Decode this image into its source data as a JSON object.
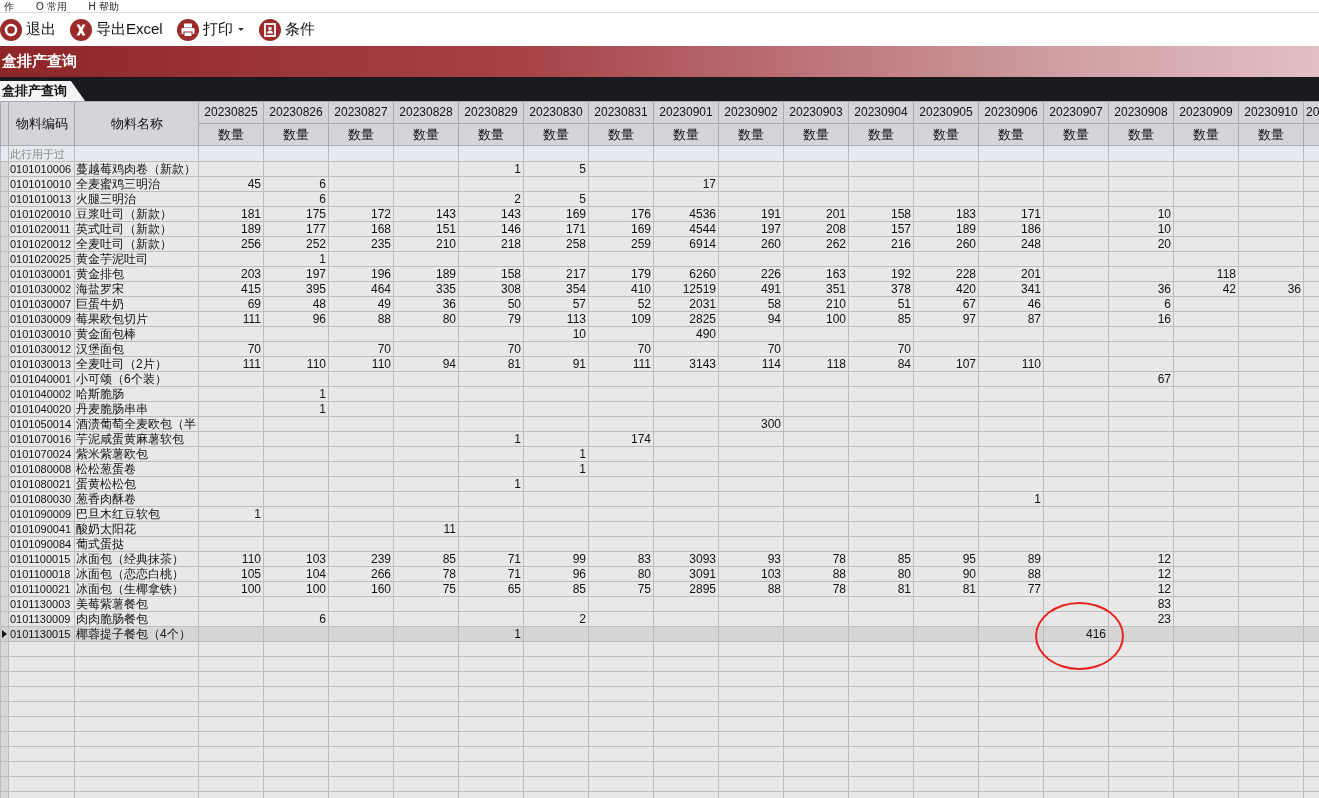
{
  "menu": [
    {
      "label": "作"
    },
    {
      "label": "O 常用"
    },
    {
      "label": "H 帮助"
    }
  ],
  "toolbar": [
    {
      "kind": "exit",
      "label": "退出",
      "dropdown": false
    },
    {
      "kind": "excel",
      "label": "导出Excel",
      "dropdown": false
    },
    {
      "kind": "print",
      "label": "打印",
      "dropdown": true
    },
    {
      "kind": "filter",
      "label": "条件",
      "dropdown": false
    }
  ],
  "title": "盒排产查询",
  "tabs": [
    {
      "label": "盒排产查询",
      "selected": true
    }
  ],
  "table": {
    "code_header": "物料编码",
    "name_header": "物料名称",
    "filter_hint": "此行用于过",
    "columns": [
      {
        "date": "20230825",
        "measure": "数量"
      },
      {
        "date": "20230826",
        "measure": "数量"
      },
      {
        "date": "20230827",
        "measure": "数量"
      },
      {
        "date": "20230828",
        "measure": "数量"
      },
      {
        "date": "20230829",
        "measure": "数量"
      },
      {
        "date": "20230830",
        "measure": "数量"
      },
      {
        "date": "20230831",
        "measure": "数量"
      },
      {
        "date": "20230901",
        "measure": "数量"
      },
      {
        "date": "20230902",
        "measure": "数量"
      },
      {
        "date": "20230903",
        "measure": "数量"
      },
      {
        "date": "20230904",
        "measure": "数量"
      },
      {
        "date": "20230905",
        "measure": "数量"
      },
      {
        "date": "20230906",
        "measure": "数量"
      },
      {
        "date": "20230907",
        "measure": "数量"
      },
      {
        "date": "20230908",
        "measure": "数量"
      },
      {
        "date": "20230909",
        "measure": "数量"
      },
      {
        "date": "20230910",
        "measure": "数量"
      },
      {
        "date": "20"
      }
    ],
    "rows": [
      {
        "code": "0101010006",
        "name": "蔓越莓鸡肉卷（新款）",
        "quantities": {
          "c4": "1",
          "c5": "5"
        },
        "selected": false,
        "circled": false
      },
      {
        "code": "0101010010",
        "name": "全麦蜜鸡三明治",
        "quantities": {
          "c0": "45",
          "c1": "6",
          "c7": "17"
        },
        "selected": false,
        "circled": false
      },
      {
        "code": "0101010013",
        "name": "火腿三明治",
        "quantities": {
          "c1": "6",
          "c4": "2",
          "c5": "5"
        },
        "selected": false,
        "circled": false
      },
      {
        "code": "0101020010",
        "name": "豆浆吐司（新款）",
        "quantities": {
          "c0": "181",
          "c1": "175",
          "c2": "172",
          "c3": "143",
          "c4": "143",
          "c5": "169",
          "c6": "176",
          "c7": "4536",
          "c8": "191",
          "c9": "201",
          "c10": "158",
          "c11": "183",
          "c12": "171",
          "c14": "10"
        },
        "selected": false,
        "circled": false
      },
      {
        "code": "0101020011",
        "name": "英式吐司（新款）",
        "quantities": {
          "c0": "189",
          "c1": "177",
          "c2": "168",
          "c3": "151",
          "c4": "146",
          "c5": "171",
          "c6": "169",
          "c7": "4544",
          "c8": "197",
          "c9": "208",
          "c10": "157",
          "c11": "189",
          "c12": "186",
          "c14": "10"
        },
        "selected": false,
        "circled": false
      },
      {
        "code": "0101020012",
        "name": "全麦吐司（新款）",
        "quantities": {
          "c0": "256",
          "c1": "252",
          "c2": "235",
          "c3": "210",
          "c4": "218",
          "c5": "258",
          "c6": "259",
          "c7": "6914",
          "c8": "260",
          "c9": "262",
          "c10": "216",
          "c11": "260",
          "c12": "248",
          "c14": "20"
        },
        "selected": false,
        "circled": false
      },
      {
        "code": "0101020025",
        "name": "黄金芋泥吐司",
        "quantities": {
          "c1": "1"
        },
        "selected": false,
        "circled": false
      },
      {
        "code": "0101030001",
        "name": "黄金排包",
        "quantities": {
          "c0": "203",
          "c1": "197",
          "c2": "196",
          "c3": "189",
          "c4": "158",
          "c5": "217",
          "c6": "179",
          "c7": "6260",
          "c8": "226",
          "c9": "163",
          "c10": "192",
          "c11": "228",
          "c12": "201",
          "c15": "118"
        },
        "selected": false,
        "circled": false
      },
      {
        "code": "0101030002",
        "name": "海盐罗宋",
        "quantities": {
          "c0": "415",
          "c1": "395",
          "c2": "464",
          "c3": "335",
          "c4": "308",
          "c5": "354",
          "c6": "410",
          "c7": "12519",
          "c8": "491",
          "c9": "351",
          "c10": "378",
          "c11": "420",
          "c12": "341",
          "c14": "36",
          "c15": "42",
          "c16": "36"
        },
        "selected": false,
        "circled": false
      },
      {
        "code": "0101030007",
        "name": "巨蛋牛奶",
        "quantities": {
          "c0": "69",
          "c1": "48",
          "c2": "49",
          "c3": "36",
          "c4": "50",
          "c5": "57",
          "c6": "52",
          "c7": "2031",
          "c8": "58",
          "c9": "210",
          "c10": "51",
          "c11": "67",
          "c12": "46",
          "c14": "6"
        },
        "selected": false,
        "circled": false
      },
      {
        "code": "0101030009",
        "name": "莓果欧包切片",
        "quantities": {
          "c0": "111",
          "c1": "96",
          "c2": "88",
          "c3": "80",
          "c4": "79",
          "c5": "113",
          "c6": "109",
          "c7": "2825",
          "c8": "94",
          "c9": "100",
          "c10": "85",
          "c11": "97",
          "c12": "87",
          "c14": "16"
        },
        "selected": false,
        "circled": false
      },
      {
        "code": "0101030010",
        "name": "黄金面包棒",
        "quantities": {
          "c5": "10",
          "c7": "490"
        },
        "selected": false,
        "circled": false
      },
      {
        "code": "0101030012",
        "name": "汉堡面包",
        "quantities": {
          "c0": "70",
          "c2": "70",
          "c4": "70",
          "c6": "70",
          "c8": "70",
          "c10": "70"
        },
        "selected": false,
        "circled": false
      },
      {
        "code": "0101030013",
        "name": "全麦吐司（2片）",
        "quantities": {
          "c0": "111",
          "c1": "110",
          "c2": "110",
          "c3": "94",
          "c4": "81",
          "c5": "91",
          "c6": "111",
          "c7": "3143",
          "c8": "114",
          "c9": "118",
          "c10": "84",
          "c11": "107",
          "c12": "110"
        },
        "selected": false,
        "circled": false
      },
      {
        "code": "0101040001",
        "name": "小可颂（6个装）",
        "quantities": {
          "c14": "67"
        },
        "selected": false,
        "circled": false
      },
      {
        "code": "0101040002",
        "name": "哈斯脆肠",
        "quantities": {
          "c1": "1"
        },
        "selected": false,
        "circled": false
      },
      {
        "code": "0101040020",
        "name": "丹麦脆肠串串",
        "quantities": {
          "c1": "1"
        },
        "selected": false,
        "circled": false
      },
      {
        "code": "0101050014",
        "name": "酒渍葡萄全麦欧包（半",
        "quantities": {
          "c8": "300"
        },
        "selected": false,
        "circled": false
      },
      {
        "code": "0101070016",
        "name": "芋泥咸蛋黄麻薯软包",
        "quantities": {
          "c4": "1",
          "c6": "174"
        },
        "selected": false,
        "circled": false
      },
      {
        "code": "0101070024",
        "name": "紫米紫薯欧包",
        "quantities": {
          "c5": "1"
        },
        "selected": false,
        "circled": false
      },
      {
        "code": "0101080008",
        "name": "松松葱蛋卷",
        "quantities": {
          "c5": "1"
        },
        "selected": false,
        "circled": false
      },
      {
        "code": "0101080021",
        "name": "蛋黄松松包",
        "quantities": {
          "c4": "1"
        },
        "selected": false,
        "circled": false
      },
      {
        "code": "0101080030",
        "name": "葱香肉酥卷",
        "quantities": {
          "c12": "1"
        },
        "selected": false,
        "circled": false
      },
      {
        "code": "0101090009",
        "name": "巴旦木红豆软包",
        "quantities": {
          "c0": "1"
        },
        "selected": false,
        "circled": false
      },
      {
        "code": "0101090041",
        "name": "酸奶太阳花",
        "quantities": {
          "c3": "11"
        },
        "selected": false,
        "circled": false
      },
      {
        "code": "0101090084",
        "name": "葡式蛋挞",
        "selected": false,
        "circled": false
      },
      {
        "code": "0101100015",
        "name": "冰面包（经典抹茶）",
        "quantities": {
          "c0": "110",
          "c1": "103",
          "c2": "239",
          "c3": "85",
          "c4": "71",
          "c5": "99",
          "c6": "83",
          "c7": "3093",
          "c8": "93",
          "c9": "78",
          "c10": "85",
          "c11": "95",
          "c12": "89",
          "c14": "12"
        },
        "selected": false,
        "circled": false
      },
      {
        "code": "0101100018",
        "name": "冰面包（恋恋白桃）",
        "quantities": {
          "c0": "105",
          "c1": "104",
          "c2": "266",
          "c3": "78",
          "c4": "71",
          "c5": "96",
          "c6": "80",
          "c7": "3091",
          "c8": "103",
          "c9": "88",
          "c10": "80",
          "c11": "90",
          "c12": "88",
          "c14": "12"
        },
        "selected": false,
        "circled": false
      },
      {
        "code": "0101100021",
        "name": "冰面包（生椰拿铁）",
        "quantities": {
          "c0": "100",
          "c1": "100",
          "c2": "160",
          "c3": "75",
          "c4": "65",
          "c5": "85",
          "c6": "75",
          "c7": "2895",
          "c8": "88",
          "c9": "78",
          "c10": "81",
          "c11": "81",
          "c12": "77",
          "c14": "12"
        },
        "selected": false,
        "circled": false
      },
      {
        "code": "0101130003",
        "name": "美莓紫薯餐包",
        "quantities": {
          "c14": "83"
        },
        "selected": false,
        "circled": false
      },
      {
        "code": "0101130009",
        "name": "肉肉脆肠餐包",
        "quantities": {
          "c1": "6",
          "c5": "2",
          "c14": "23"
        },
        "selected": false,
        "circled": false
      },
      {
        "code": "0101130015",
        "name": "椰蓉提子餐包（4个）",
        "quantities": {
          "c4": "1",
          "c13": "416"
        },
        "selected": true,
        "circled": true
      }
    ]
  }
}
